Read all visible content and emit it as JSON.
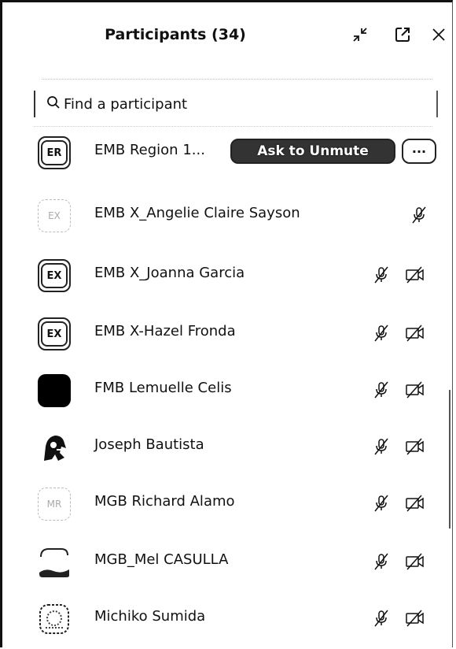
{
  "header": {
    "title": "Participants (34)",
    "icons": [
      "minimize-icon",
      "pop-out-icon",
      "close-icon"
    ]
  },
  "search": {
    "placeholder": "Find a participant",
    "value": ""
  },
  "participants": [
    {
      "avatar_text": "ER",
      "name": "EMB Region 1...",
      "ask_label": "Ask to Unmute",
      "more_label": "···"
    },
    {
      "avatar_text": "EX",
      "name": "EMB X_Angelie Claire Sayson"
    },
    {
      "avatar_text": "EX",
      "name": "EMB X_Joanna Garcia"
    },
    {
      "avatar_text": "EX",
      "name": "EMB X-Hazel Fronda"
    },
    {
      "avatar_text": "",
      "name": "FMB Lemuelle Celis"
    },
    {
      "avatar_text": "",
      "name": "Joseph Bautista"
    },
    {
      "avatar_text": "MR",
      "name": "MGB Richard Alamo"
    },
    {
      "avatar_text": "",
      "name": "MGB_Mel CASULLA"
    },
    {
      "avatar_text": "",
      "name": "Michiko Sumida"
    }
  ]
}
